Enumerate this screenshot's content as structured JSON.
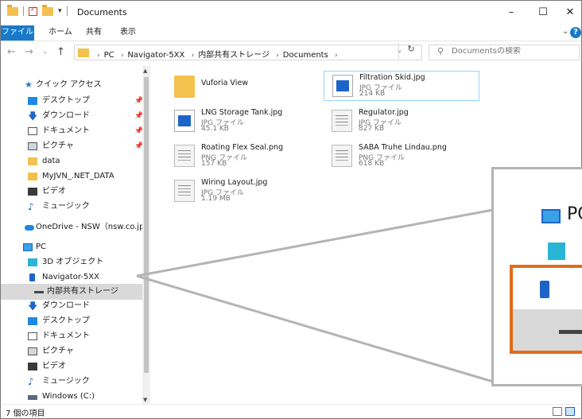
{
  "window": {
    "title": "Documents",
    "controls": {
      "minimize": "–",
      "maximize": "☐",
      "close": "✕"
    }
  },
  "ribbon": {
    "tabs": [
      "ファイル",
      "ホーム",
      "共有",
      "表示"
    ],
    "expand_icon": "chevron-down-icon",
    "help_label": "?"
  },
  "address": {
    "path": [
      "PC",
      "Navigator-5XX",
      "内部共有ストレージ",
      "Documents"
    ],
    "search_placeholder": "Documentsの検索"
  },
  "nav_pane": {
    "items": [
      {
        "label": "クイック アクセス",
        "icon": "star-icon"
      },
      {
        "label": "デスクトップ",
        "icon": "desktop-icon",
        "pinned": true
      },
      {
        "label": "ダウンロード",
        "icon": "download-icon",
        "pinned": true
      },
      {
        "label": "ドキュメント",
        "icon": "document-icon",
        "pinned": true
      },
      {
        "label": "ピクチャ",
        "icon": "pictures-icon",
        "pinned": true
      },
      {
        "label": "data",
        "icon": "folder-icon"
      },
      {
        "label": "MyJVN_.NET_DATA",
        "icon": "folder-icon"
      },
      {
        "label": "ビデオ",
        "icon": "video-icon"
      },
      {
        "label": "ミュージック",
        "icon": "music-icon"
      },
      {
        "label": "OneDrive - NSW（nsw.co.jp）",
        "icon": "cloud-icon"
      },
      {
        "label": "PC",
        "icon": "pc-icon"
      },
      {
        "label": "3D オブジェクト",
        "icon": "3d-objects-icon"
      },
      {
        "label": "Navigator-5XX",
        "icon": "phone-icon"
      },
      {
        "label": "内部共有ストレージ",
        "icon": "drive-icon",
        "selected": true
      },
      {
        "label": "ダウンロード",
        "icon": "download-icon"
      },
      {
        "label": "デスクトップ",
        "icon": "desktop-icon"
      },
      {
        "label": "ドキュメント",
        "icon": "document-icon"
      },
      {
        "label": "ピクチャ",
        "icon": "pictures-icon"
      },
      {
        "label": "ビデオ",
        "icon": "video-icon"
      },
      {
        "label": "ミュージック",
        "icon": "music-icon"
      },
      {
        "label": "Windows (C:)",
        "icon": "windows-drive-icon"
      }
    ]
  },
  "files": [
    {
      "name": "Vuforia View",
      "type": "",
      "size": "",
      "icon": "folder-icon"
    },
    {
      "name": "Filtration Skid.jpg",
      "type": "JPG ファイル",
      "size": "214 KB",
      "icon": "image-icon",
      "selected": true
    },
    {
      "name": "LNG Storage Tank.jpg",
      "type": "JPG ファイル",
      "size": "45.1 KB",
      "icon": "image-icon"
    },
    {
      "name": "Regulator.jpg",
      "type": "JPG ファイル",
      "size": "827 KB",
      "icon": "sketch-thumbnail-icon"
    },
    {
      "name": "Roating Flex Seal.png",
      "type": "PNG ファイル",
      "size": "157 KB",
      "icon": "sketch-thumbnail-icon"
    },
    {
      "name": "SABA Truhe Lindau.png",
      "type": "PNG ファイル",
      "size": "618 KB",
      "icon": "sketch-thumbnail-icon"
    },
    {
      "name": "Wiring Layout.jpg",
      "type": "JPG ファイル",
      "size": "1.19 MB",
      "icon": "sketch-thumbnail-icon"
    }
  ],
  "status": {
    "count": "7 個の項目"
  },
  "zoom_callout": {
    "pc_label": "PC"
  },
  "colors": {
    "accent": "#1979ca",
    "highlight": "#e06c1a",
    "selection": "#d9d9d9"
  }
}
